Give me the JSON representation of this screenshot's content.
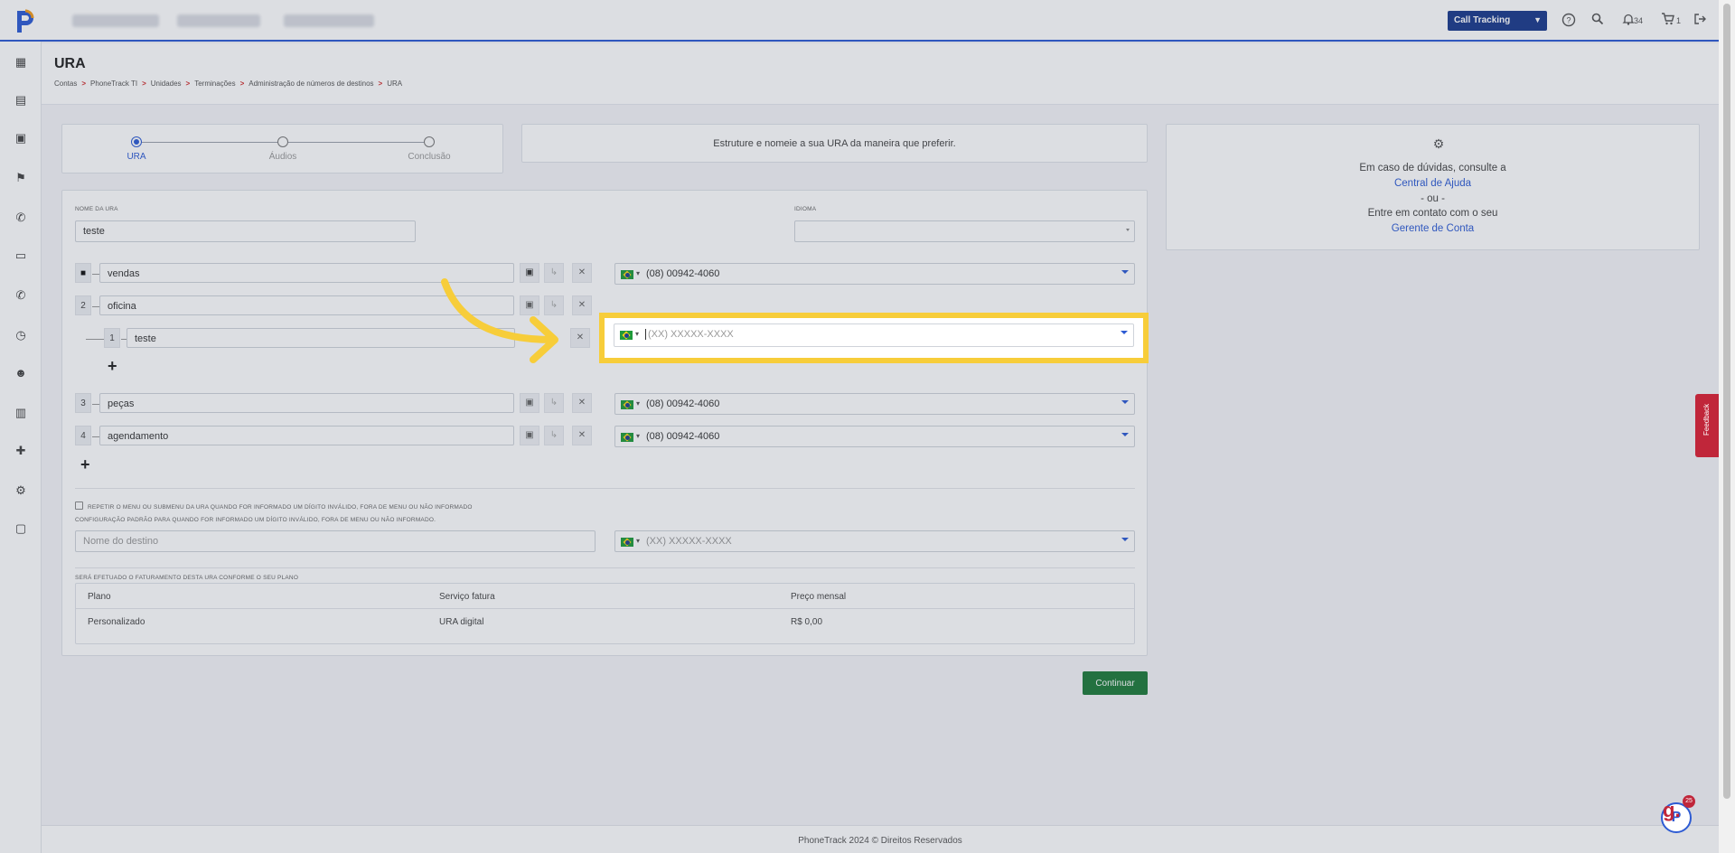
{
  "topbar": {
    "product_select": "Call Tracking",
    "notifications_count": "34",
    "cart_count": "1"
  },
  "page": {
    "title": "URA",
    "breadcrumb": [
      "Contas",
      "PhoneTrack TI",
      "Unidades",
      "Terminações",
      "Administração de números de destinos",
      "URA"
    ]
  },
  "stepper": {
    "steps": [
      "URA",
      "Áudios",
      "Conclusão"
    ],
    "active": 0
  },
  "hint": "Estruture e nomeie a sua URA da maneira que preferir.",
  "help": {
    "line1": "Em caso de dúvidas, consulte a",
    "link1": "Central de Ajuda",
    "or": "- ou -",
    "line2": "Entre em contato com o seu",
    "link2": "Gerente de Conta"
  },
  "form": {
    "name_label": "Nome da URA",
    "name_value": "teste",
    "language_label": "Idioma",
    "language_value": "",
    "menu_items": [
      {
        "key": "1",
        "name": "vendas",
        "phone": "(08) 00942-4060"
      },
      {
        "key": "2",
        "name": "oficina",
        "phone": ""
      },
      {
        "key": "3",
        "name": "peças",
        "phone": "(08) 00942-4060"
      },
      {
        "key": "4",
        "name": "agendamento",
        "phone": "(08) 00942-4060"
      }
    ],
    "submenu_item": {
      "key": "1",
      "name": "teste",
      "phone_placeholder": "(XX) XXXXX-XXXX"
    },
    "repeat_label": "Repetir o menu ou submenu da URA quando for informado um dígito inválido, fora de menu ou não informado",
    "default_config_label": "Configuração padrão para quando for informado um dígito inválido, fora de menu ou não informado.",
    "destination_placeholder": "Nome do destino",
    "destination_phone_placeholder": "(XX) XXXXX-XXXX",
    "billing_label": "Será efetuado o faturamento desta URA conforme o seu plano"
  },
  "billing_table": {
    "headers": [
      "Plano",
      "Serviço fatura",
      "Preço mensal"
    ],
    "row": [
      "Personalizado",
      "URA digital",
      "R$ 0,00"
    ]
  },
  "buttons": {
    "continue": "Continuar"
  },
  "feedback": "Feedback",
  "chat_badge": "25",
  "footer": "PhoneTrack 2024 © Direitos Reservados",
  "colors": {
    "brand_blue": "#2d5bd3",
    "highlight": "#f7cd3a",
    "continue_green": "#1e7a3a",
    "feedback_red": "#c0263a"
  }
}
